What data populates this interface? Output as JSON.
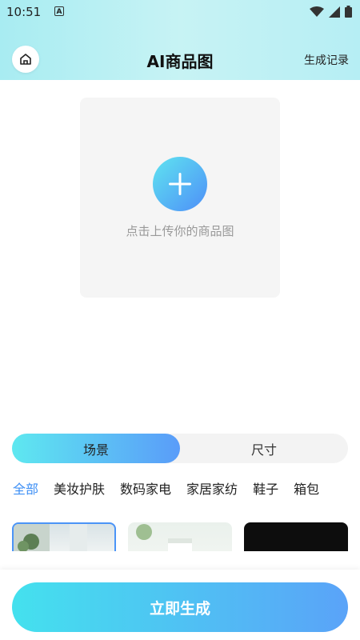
{
  "status_bar": {
    "time": "10:51",
    "notification_icon": "a-badge-icon"
  },
  "header": {
    "title": "AI商品图",
    "history_label": "生成记录"
  },
  "upload": {
    "hint": "点击上传你的商品图"
  },
  "segment": {
    "options": [
      "场景",
      "尺寸"
    ],
    "selected": "场景"
  },
  "categories": {
    "items": [
      "全部",
      "美妆护肤",
      "数码家电",
      "家居家纺",
      "鞋子",
      "箱包"
    ],
    "selected": "全部"
  },
  "action": {
    "generate_label": "立即生成"
  },
  "colors": {
    "accent": "#3d8ff5",
    "gradient_start": "#44e1ee",
    "gradient_end": "#5aa3f8"
  }
}
